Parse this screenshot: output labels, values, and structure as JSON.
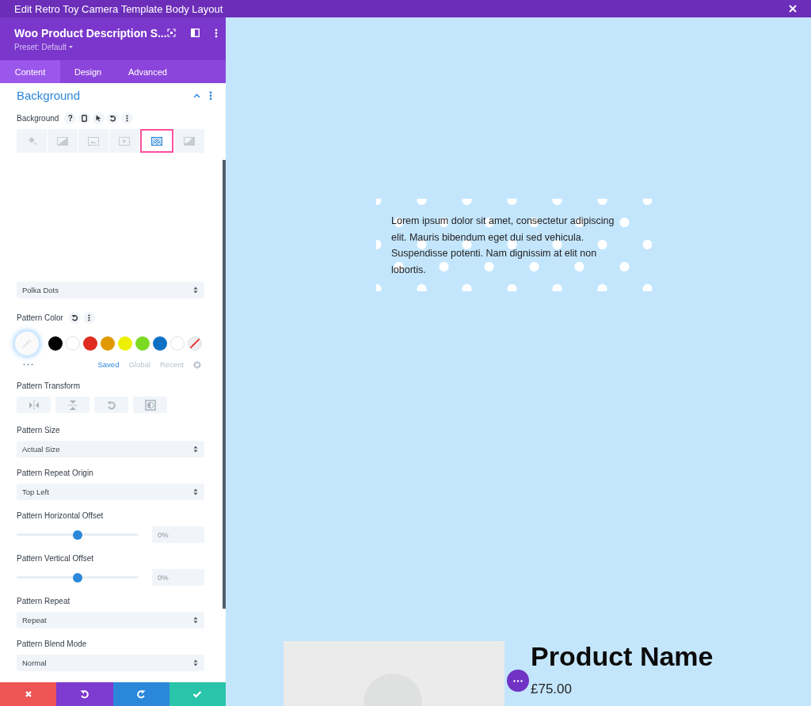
{
  "window": {
    "title": "Edit Retro Toy Camera Template Body Layout"
  },
  "module": {
    "title": "Woo Product Description S...",
    "preset": "Preset: Default"
  },
  "tabs": [
    {
      "label": "Content",
      "selected": true
    },
    {
      "label": "Design",
      "selected": false
    },
    {
      "label": "Advanced",
      "selected": false
    }
  ],
  "section": {
    "title": "Background",
    "expanded": true
  },
  "background": {
    "label": "Background",
    "help": "?",
    "types": [
      {
        "kind": "color",
        "selected": false
      },
      {
        "kind": "gradient",
        "selected": false
      },
      {
        "kind": "image",
        "selected": false
      },
      {
        "kind": "video",
        "selected": false
      },
      {
        "kind": "pattern",
        "selected": true
      },
      {
        "kind": "mask",
        "selected": false
      }
    ]
  },
  "pattern_style": {
    "value": "Polka Dots"
  },
  "pattern_color": {
    "label": "Pattern Color",
    "swatches": [
      {
        "kind": "color",
        "color": "#000000",
        "selected": false
      },
      {
        "kind": "color",
        "color": "#ffffff",
        "selected": false
      },
      {
        "kind": "color",
        "color": "#e02b20",
        "selected": false
      },
      {
        "kind": "color",
        "color": "#e09900",
        "selected": false
      },
      {
        "kind": "color",
        "color": "#edf000",
        "selected": false
      },
      {
        "kind": "color",
        "color": "#7cda24",
        "selected": false
      },
      {
        "kind": "color",
        "color": "#0c71c3",
        "selected": false
      },
      {
        "kind": "color",
        "color": "#ffffff",
        "selected": false
      },
      {
        "kind": "none",
        "selected": false
      }
    ],
    "palette_tabs": [
      {
        "label": "Saved",
        "selected": true
      },
      {
        "label": "Global",
        "selected": false
      },
      {
        "label": "Recent",
        "selected": false
      }
    ]
  },
  "pattern_transform": {
    "label": "Pattern Transform",
    "buttons": [
      {
        "kind": "flip-horizontal"
      },
      {
        "kind": "flip-vertical"
      },
      {
        "kind": "rotate"
      },
      {
        "kind": "invert"
      }
    ]
  },
  "settings": [
    {
      "kind": "select",
      "label": "Pattern Size",
      "value": "Actual Size"
    },
    {
      "kind": "select",
      "label": "Pattern Repeat Origin",
      "value": "Top Left"
    },
    {
      "kind": "slider",
      "label": "Pattern Horizontal Offset",
      "level": 0.5,
      "placeholder": "0%"
    },
    {
      "kind": "slider",
      "label": "Pattern Vertical Offset",
      "level": 0.5,
      "placeholder": "0%"
    },
    {
      "kind": "select",
      "label": "Pattern Repeat",
      "value": "Repeat"
    },
    {
      "kind": "select",
      "label": "Pattern Blend Mode",
      "value": "Normal"
    }
  ],
  "actions": [
    {
      "kind": "discard"
    },
    {
      "kind": "undo"
    },
    {
      "kind": "redo"
    },
    {
      "kind": "save"
    }
  ],
  "preview": {
    "description": "Lorem ipsum dolor sit amet, consectetur adipiscing elit. Mauris bibendum eget dui sed vehicula. Suspendisse potenti. Nam dignissim at elit non lobortis.",
    "product_name": "Product Name",
    "price": "£75.00"
  }
}
